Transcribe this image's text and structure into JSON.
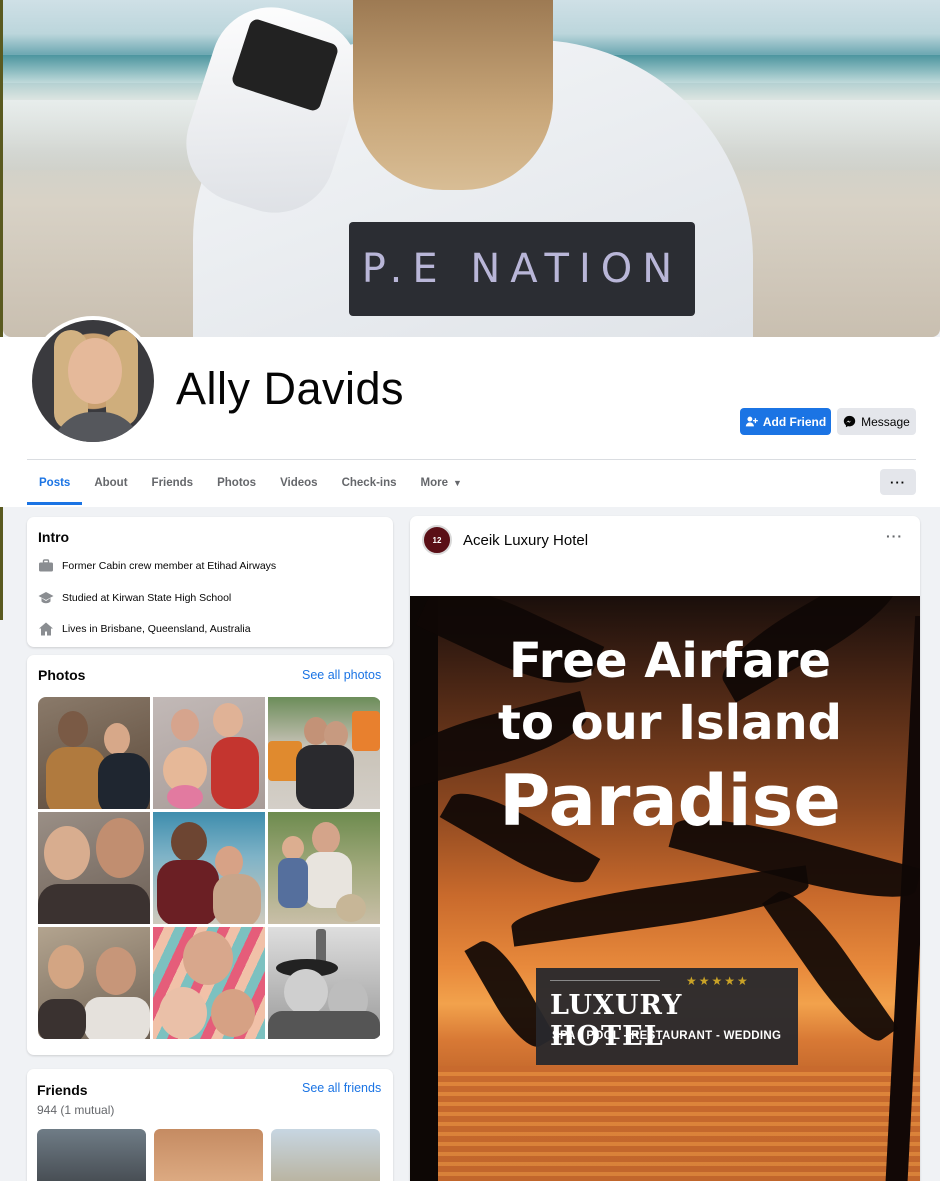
{
  "cover": {
    "patch_text": "P.E NATION"
  },
  "profile": {
    "name": "Ally Davids"
  },
  "actions": {
    "add_friend": "Add Friend",
    "message": "Message",
    "more": "···"
  },
  "tabs": [
    {
      "label": "Posts"
    },
    {
      "label": "About"
    },
    {
      "label": "Friends"
    },
    {
      "label": "Photos"
    },
    {
      "label": "Videos"
    },
    {
      "label": "Check-ins"
    },
    {
      "label": "More"
    }
  ],
  "intro": {
    "title": "Intro",
    "work_prefix": "Former Cabin crew member at ",
    "work_place": "Etihad Airways",
    "study_prefix": "Studied at ",
    "study_place": "Kirwan State High School",
    "lives_prefix": "Lives in ",
    "lives_place": "Brisbane, Queensland, Australia"
  },
  "photos": {
    "title": "Photos",
    "see_all": "See all photos"
  },
  "friends": {
    "title": "Friends",
    "see_all": "See all friends",
    "count": "944 (1 mutual)"
  },
  "post": {
    "author": "Aceik Luxury Hotel",
    "avatar_text": "12",
    "menu": "···",
    "ad_line1": "Free Airfare",
    "ad_line2": "to our Island",
    "ad_line3": "Paradise",
    "badge_stars": "★★★★★",
    "badge_title": "LUXURY  HOTEL",
    "badge_sub": "SPA - POOL - RESTAURANT - WEDDING"
  }
}
